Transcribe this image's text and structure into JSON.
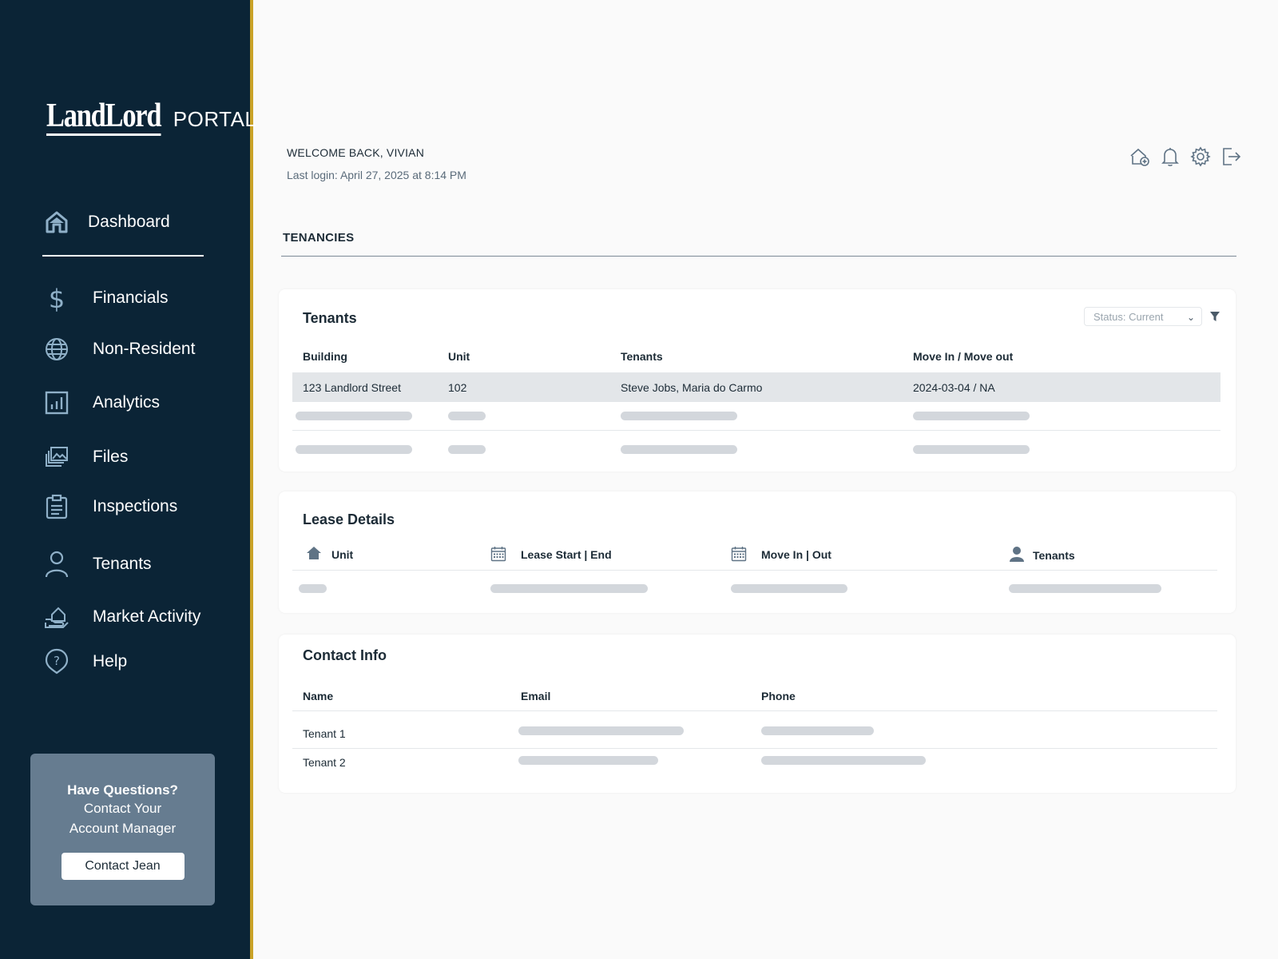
{
  "brand": {
    "main": "LandLord",
    "sub": "PORTAL"
  },
  "sidebar": {
    "items": [
      {
        "label": "Dashboard",
        "icon": "home-icon",
        "active": true
      },
      {
        "label": "Financials",
        "icon": "dollar-icon"
      },
      {
        "label": "Non-Resident",
        "icon": "globe-icon"
      },
      {
        "label": "Analytics",
        "icon": "analytics-icon"
      },
      {
        "label": "Files",
        "icon": "files-icon"
      },
      {
        "label": "Inspections",
        "icon": "clipboard-icon"
      },
      {
        "label": "Tenants",
        "icon": "user-icon"
      },
      {
        "label": "Market Activity",
        "icon": "market-icon"
      },
      {
        "label": "Help",
        "icon": "help-icon"
      }
    ],
    "help_box": {
      "question": "Have Questions?",
      "line1": "Contact Your",
      "line2": "Account Manager",
      "button_label": "Contact Jean"
    }
  },
  "header": {
    "welcome": "WELCOME BACK, VIVIAN",
    "last_login": "Last login: April 27, 2025 at 8:14 PM",
    "icons": [
      "home-add-icon",
      "bell-icon",
      "gear-icon",
      "logout-icon"
    ]
  },
  "section": {
    "title": "TENANCIES"
  },
  "tenants_card": {
    "title": "Tenants",
    "status_filter": "Status: Current",
    "columns": [
      "Building",
      "Unit",
      "Tenants",
      "Move In / Move out"
    ],
    "rows": [
      {
        "building": "123 Landlord Street",
        "unit": "102",
        "tenants": "Steve Jobs, Maria do Carmo",
        "move": "2024-03-04 / NA"
      }
    ]
  },
  "lease_card": {
    "title": "Lease Details",
    "columns": [
      {
        "label": "Unit",
        "icon": "house-icon"
      },
      {
        "label": "Lease Start | End",
        "icon": "calendar-icon"
      },
      {
        "label": "Move In | Out",
        "icon": "calendar-icon"
      },
      {
        "label": "Tenants",
        "icon": "person-icon"
      }
    ]
  },
  "contact_card": {
    "title": "Contact Info",
    "columns": [
      "Name",
      "Email",
      "Phone"
    ],
    "rows": [
      "Tenant 1",
      "Tenant 2"
    ]
  },
  "colors": {
    "sidebar": "#0b2436",
    "accent": "#c9a227",
    "help_box": "#667c90",
    "highlight_row": "#e3e6e9"
  }
}
